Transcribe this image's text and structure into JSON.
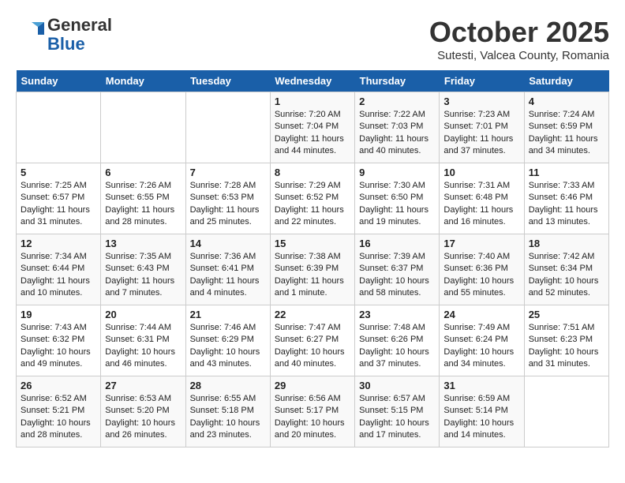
{
  "header": {
    "logo_general": "General",
    "logo_blue": "Blue",
    "month": "October 2025",
    "location": "Sutesti, Valcea County, Romania"
  },
  "days_of_week": [
    "Sunday",
    "Monday",
    "Tuesday",
    "Wednesday",
    "Thursday",
    "Friday",
    "Saturday"
  ],
  "weeks": [
    [
      {
        "day": "",
        "info": ""
      },
      {
        "day": "",
        "info": ""
      },
      {
        "day": "",
        "info": ""
      },
      {
        "day": "1",
        "info": "Sunrise: 7:20 AM\nSunset: 7:04 PM\nDaylight: 11 hours and 44 minutes."
      },
      {
        "day": "2",
        "info": "Sunrise: 7:22 AM\nSunset: 7:03 PM\nDaylight: 11 hours and 40 minutes."
      },
      {
        "day": "3",
        "info": "Sunrise: 7:23 AM\nSunset: 7:01 PM\nDaylight: 11 hours and 37 minutes."
      },
      {
        "day": "4",
        "info": "Sunrise: 7:24 AM\nSunset: 6:59 PM\nDaylight: 11 hours and 34 minutes."
      }
    ],
    [
      {
        "day": "5",
        "info": "Sunrise: 7:25 AM\nSunset: 6:57 PM\nDaylight: 11 hours and 31 minutes."
      },
      {
        "day": "6",
        "info": "Sunrise: 7:26 AM\nSunset: 6:55 PM\nDaylight: 11 hours and 28 minutes."
      },
      {
        "day": "7",
        "info": "Sunrise: 7:28 AM\nSunset: 6:53 PM\nDaylight: 11 hours and 25 minutes."
      },
      {
        "day": "8",
        "info": "Sunrise: 7:29 AM\nSunset: 6:52 PM\nDaylight: 11 hours and 22 minutes."
      },
      {
        "day": "9",
        "info": "Sunrise: 7:30 AM\nSunset: 6:50 PM\nDaylight: 11 hours and 19 minutes."
      },
      {
        "day": "10",
        "info": "Sunrise: 7:31 AM\nSunset: 6:48 PM\nDaylight: 11 hours and 16 minutes."
      },
      {
        "day": "11",
        "info": "Sunrise: 7:33 AM\nSunset: 6:46 PM\nDaylight: 11 hours and 13 minutes."
      }
    ],
    [
      {
        "day": "12",
        "info": "Sunrise: 7:34 AM\nSunset: 6:44 PM\nDaylight: 11 hours and 10 minutes."
      },
      {
        "day": "13",
        "info": "Sunrise: 7:35 AM\nSunset: 6:43 PM\nDaylight: 11 hours and 7 minutes."
      },
      {
        "day": "14",
        "info": "Sunrise: 7:36 AM\nSunset: 6:41 PM\nDaylight: 11 hours and 4 minutes."
      },
      {
        "day": "15",
        "info": "Sunrise: 7:38 AM\nSunset: 6:39 PM\nDaylight: 11 hours and 1 minute."
      },
      {
        "day": "16",
        "info": "Sunrise: 7:39 AM\nSunset: 6:37 PM\nDaylight: 10 hours and 58 minutes."
      },
      {
        "day": "17",
        "info": "Sunrise: 7:40 AM\nSunset: 6:36 PM\nDaylight: 10 hours and 55 minutes."
      },
      {
        "day": "18",
        "info": "Sunrise: 7:42 AM\nSunset: 6:34 PM\nDaylight: 10 hours and 52 minutes."
      }
    ],
    [
      {
        "day": "19",
        "info": "Sunrise: 7:43 AM\nSunset: 6:32 PM\nDaylight: 10 hours and 49 minutes."
      },
      {
        "day": "20",
        "info": "Sunrise: 7:44 AM\nSunset: 6:31 PM\nDaylight: 10 hours and 46 minutes."
      },
      {
        "day": "21",
        "info": "Sunrise: 7:46 AM\nSunset: 6:29 PM\nDaylight: 10 hours and 43 minutes."
      },
      {
        "day": "22",
        "info": "Sunrise: 7:47 AM\nSunset: 6:27 PM\nDaylight: 10 hours and 40 minutes."
      },
      {
        "day": "23",
        "info": "Sunrise: 7:48 AM\nSunset: 6:26 PM\nDaylight: 10 hours and 37 minutes."
      },
      {
        "day": "24",
        "info": "Sunrise: 7:49 AM\nSunset: 6:24 PM\nDaylight: 10 hours and 34 minutes."
      },
      {
        "day": "25",
        "info": "Sunrise: 7:51 AM\nSunset: 6:23 PM\nDaylight: 10 hours and 31 minutes."
      }
    ],
    [
      {
        "day": "26",
        "info": "Sunrise: 6:52 AM\nSunset: 5:21 PM\nDaylight: 10 hours and 28 minutes."
      },
      {
        "day": "27",
        "info": "Sunrise: 6:53 AM\nSunset: 5:20 PM\nDaylight: 10 hours and 26 minutes."
      },
      {
        "day": "28",
        "info": "Sunrise: 6:55 AM\nSunset: 5:18 PM\nDaylight: 10 hours and 23 minutes."
      },
      {
        "day": "29",
        "info": "Sunrise: 6:56 AM\nSunset: 5:17 PM\nDaylight: 10 hours and 20 minutes."
      },
      {
        "day": "30",
        "info": "Sunrise: 6:57 AM\nSunset: 5:15 PM\nDaylight: 10 hours and 17 minutes."
      },
      {
        "day": "31",
        "info": "Sunrise: 6:59 AM\nSunset: 5:14 PM\nDaylight: 10 hours and 14 minutes."
      },
      {
        "day": "",
        "info": ""
      }
    ]
  ]
}
